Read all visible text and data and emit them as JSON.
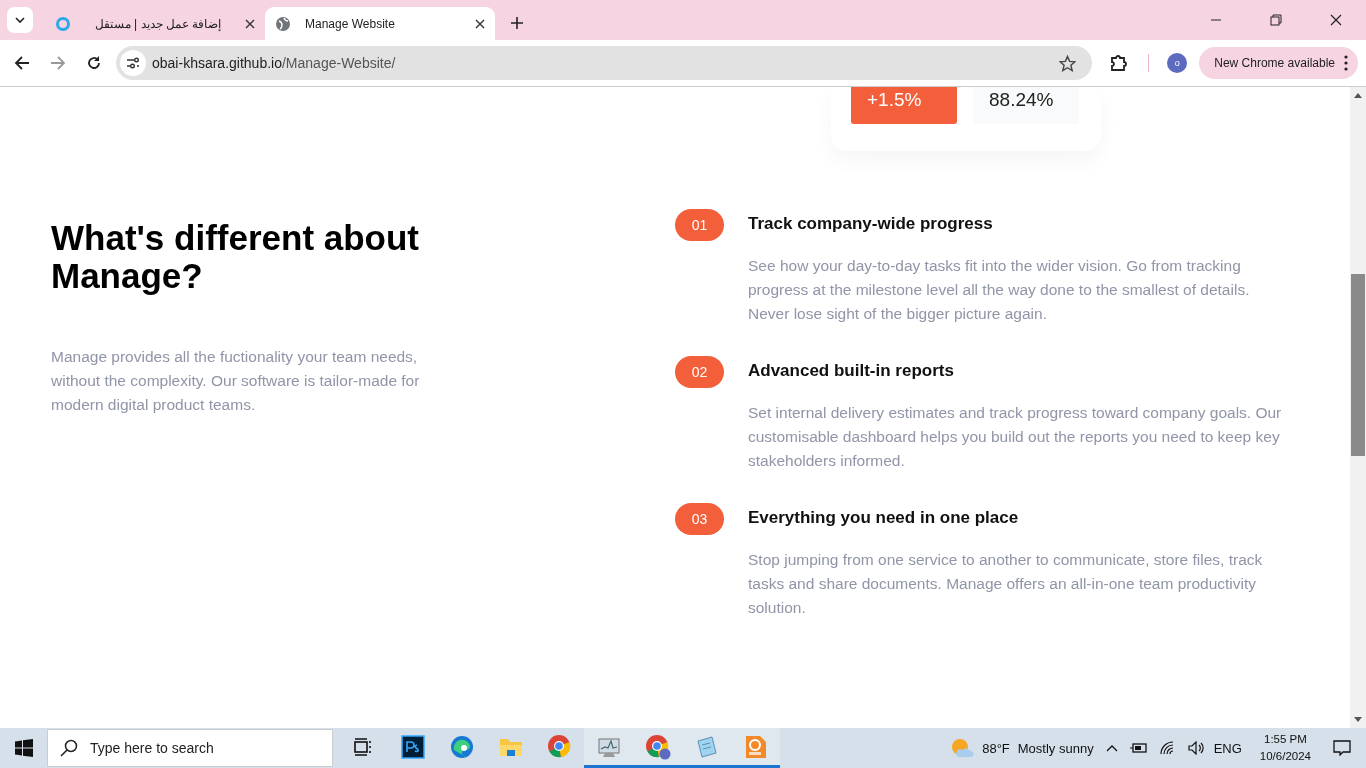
{
  "browser": {
    "tabs": [
      {
        "title": "إضافة عمل جديد | مستقل",
        "selected": false
      },
      {
        "title": "Manage Website",
        "selected": true
      }
    ],
    "url_host": "obai-khsara.github.io",
    "url_path": "/Manage-Website/",
    "profile_initial": "o",
    "update_button": "New Chrome available"
  },
  "stats_card": {
    "change": "+1.5%",
    "value": "88.24%"
  },
  "intro": {
    "heading": "What's different about Manage?",
    "text": "Manage provides all the fuctionality your team needs, without the complexity. Our software is tailor-made for modern digital product teams."
  },
  "features": [
    {
      "number": "01",
      "title": "Track company-wide progress",
      "text": "See how your day-to-day tasks fit into the wider vision. Go from tracking progress at the milestone level all the way done to the smallest of details. Never lose sight of the bigger picture again."
    },
    {
      "number": "02",
      "title": "Advanced built-in reports",
      "text": "Set internal delivery estimates and track progress toward company goals. Our customisable dashboard helps you build out the reports you need to keep key stakeholders informed."
    },
    {
      "number": "03",
      "title": "Everything you need in one place",
      "text": "Stop jumping from one service to another to communicate, store files, track tasks and share documents. Manage offers an all-in-one team productivity solution."
    }
  ],
  "taskbar": {
    "search_placeholder": "Type here to search",
    "apps": [
      {
        "kind": "taskview",
        "running": false
      },
      {
        "kind": "photoshop",
        "running": false
      },
      {
        "kind": "edge",
        "running": false
      },
      {
        "kind": "folder",
        "running": false
      },
      {
        "kind": "chrome",
        "running": false
      },
      {
        "kind": "monitor",
        "running": true
      },
      {
        "kind": "chrome-profile",
        "running": true
      },
      {
        "kind": "notepad",
        "running": true
      },
      {
        "kind": "pdf",
        "running": true
      }
    ],
    "temperature": "88°F",
    "weather": "Mostly sunny",
    "language": "ENG",
    "time": "1:55 PM",
    "date": "10/6/2024"
  }
}
